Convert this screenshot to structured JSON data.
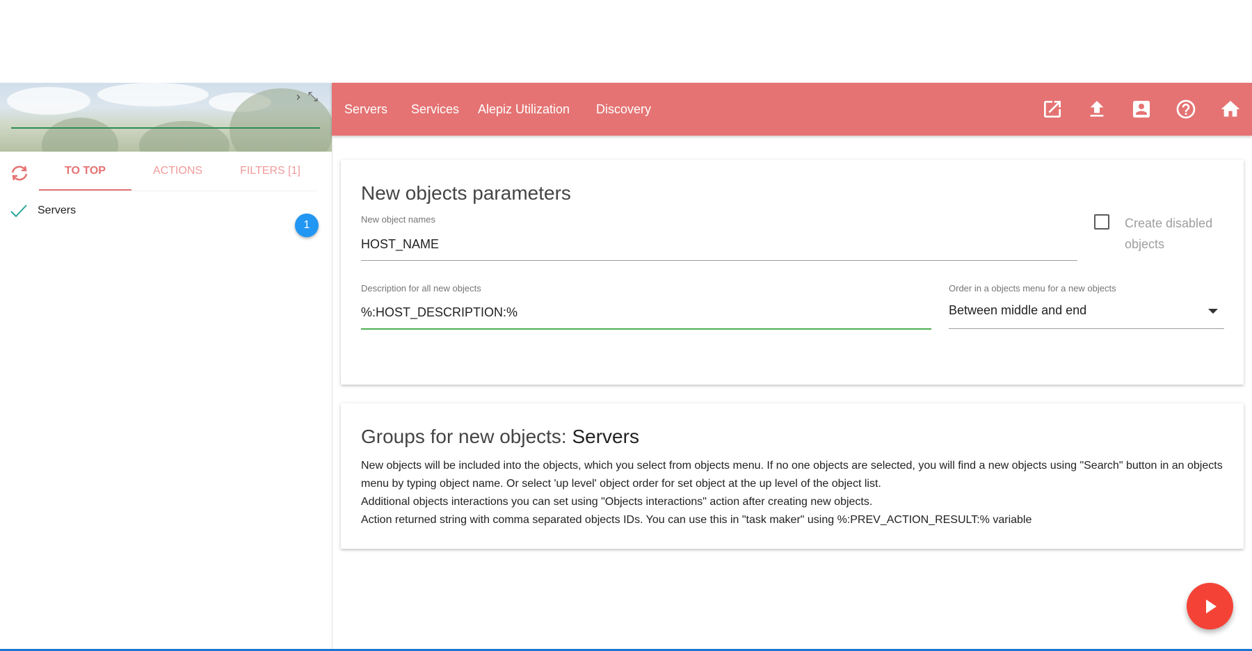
{
  "search": {
    "value": "",
    "placeholder": ""
  },
  "hero_icons": {
    "expand": "›",
    "collapse": "⤡"
  },
  "tabs": [
    {
      "label": "TO TOP"
    },
    {
      "label": "ACTIONS"
    },
    {
      "label": "FILTERS [1]"
    }
  ],
  "object_list": {
    "items": [
      {
        "label": "Servers",
        "checked": true
      }
    ],
    "badge": "1"
  },
  "nav": {
    "items": [
      {
        "label": "Servers"
      },
      {
        "label": "Services"
      },
      {
        "label": "Alepiz Utilization"
      },
      {
        "label": "Discovery"
      }
    ],
    "icons": [
      "open-in-new-icon",
      "upload-icon",
      "account-box-icon",
      "help-icon",
      "home-icon"
    ],
    "color": "#e57373"
  },
  "params_card": {
    "title": "New objects parameters",
    "names_label": "New object names",
    "names_value": "HOST_NAME",
    "disabled_checkbox_label": "Create disabled objects",
    "disabled_checked": false,
    "description_label": "Description for all new objects",
    "description_value": "%:HOST_DESCRIPTION:%",
    "order_label": "Order in a objects menu for a new objects",
    "order_value": "Between middle and end"
  },
  "groups_card": {
    "title_prefix": "Groups for new objects:",
    "title_value": "Servers",
    "lines": [
      "New objects will be included into the objects, which you select from objects menu. If no one objects are selected, you will find a new objects using \"Search\" button in an objects menu by typing object name. Or select 'up level' object order for set object at the up level of the object list.",
      "Additional objects interactions you can set using \"Objects interactions\" action after creating new objects.",
      "Action returned string with comma separated objects IDs. You can use this in \"task maker\" using %:PREV_ACTION_RESULT:% variable"
    ]
  },
  "colors": {
    "accent": "#e57373",
    "badge": "#2196f3",
    "fab": "#f44336",
    "input_focus": "#4caf50"
  }
}
